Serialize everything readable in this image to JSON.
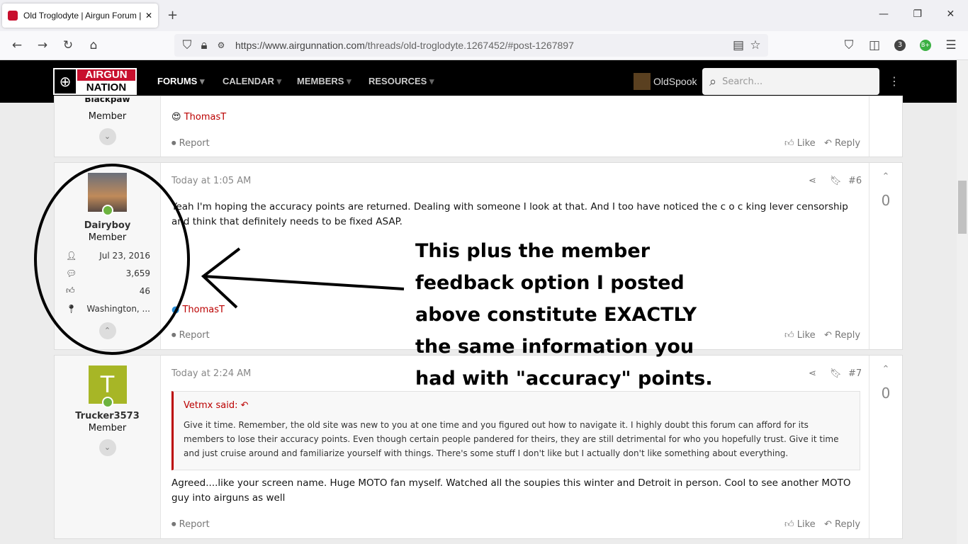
{
  "browser": {
    "tab_title": "Old Troglodyte | Airgun Forum | ",
    "url_host": "https://www.airgunnation.com",
    "url_path": "/threads/old-troglodyte.1267452/#post-1267897",
    "ext_badge": "3",
    "ext_grade": "B+"
  },
  "site": {
    "logo_top": "AIRGUN",
    "logo_bottom": "NATION",
    "nav": [
      "FORUMS",
      "CALENDAR",
      "MEMBERS",
      "RESOURCES"
    ],
    "user": "OldSpook",
    "search_placeholder": "Search..."
  },
  "posts": [
    {
      "username": "Blackpaw",
      "role": "Member",
      "reaction_user": "ThomasT",
      "report": "Report",
      "like": "Like",
      "reply": "Reply"
    },
    {
      "username": "Dairyboy",
      "role": "Member",
      "joined": "Jul 23, 2016",
      "messages": "3,659",
      "reactions": "46",
      "location": "Washington, ...",
      "time": "Today at 1:05 AM",
      "number": "#6",
      "votes": "0",
      "body": "Yeah I'm hoping the accuracy points are returned. Dealing with someone I look at that. And I too have noticed the c o c king lever censorship and think that definitely needs to be fixed ASAP.",
      "reaction_user": "ThomasT",
      "report": "Report",
      "like": "Like",
      "reply": "Reply"
    },
    {
      "username": "Trucker3573",
      "avatar_letter": "T",
      "role": "Member",
      "time": "Today at 2:24 AM",
      "number": "#7",
      "votes": "0",
      "quote_author": "Vetmx said:",
      "quote": "Give it time. Remember, the old site was new to you at one time and you figured out how to navigate it. I highly doubt this forum can afford for its members to lose their accuracy points. Even though certain people pandered for theirs, they are still detrimental for who you hopefully trust. Give it time and just cruise around and familiarize yourself with things. There's some stuff I don't like but I actually don't like something about everything.",
      "body": "Agreed....like your screen name. Huge MOTO fan myself. Watched all the soupies this winter and Detroit in person. Cool to see another MOTO guy into airguns as well",
      "report": "Report",
      "like": "Like",
      "reply": "Reply"
    }
  ],
  "annotation": [
    "This plus the member",
    "feedback option I posted",
    "above constitute EXACTLY",
    "the same information you",
    "had with \"accuracy\" points."
  ],
  "colors": {
    "accent": "#b00000",
    "online": "#6db33f",
    "avatar_t": "#a7b626"
  }
}
